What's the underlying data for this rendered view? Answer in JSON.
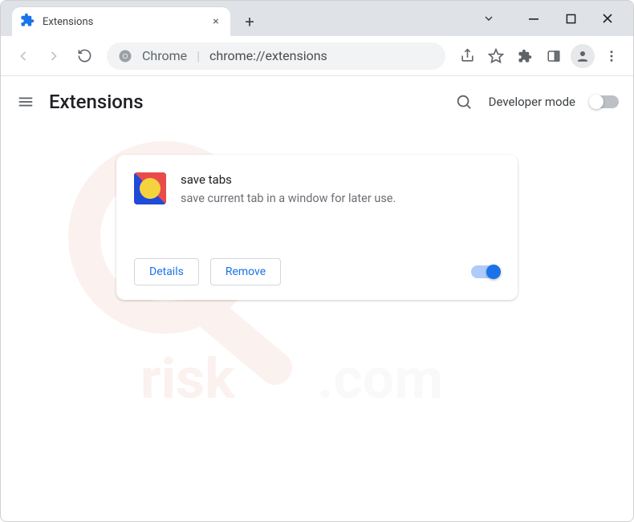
{
  "window": {
    "tab_title": "Extensions",
    "newtab_glyph": "+",
    "close_glyph": "×"
  },
  "omnibox": {
    "chrome_label": "Chrome",
    "divider": "|",
    "url": "chrome://extensions"
  },
  "header": {
    "title": "Extensions",
    "dev_mode_label": "Developer mode",
    "dev_mode_on": false
  },
  "extension": {
    "name": "save tabs",
    "description": "save current tab in a window for later use.",
    "details_label": "Details",
    "remove_label": "Remove",
    "enabled": true
  }
}
